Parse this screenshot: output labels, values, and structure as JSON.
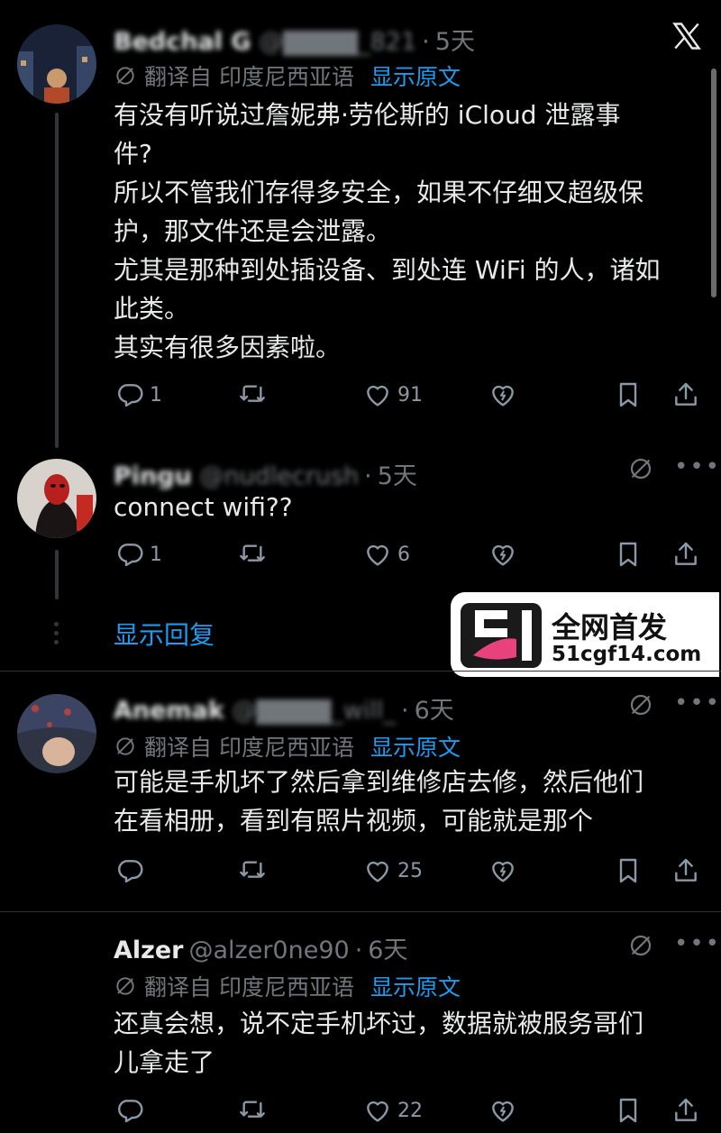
{
  "header": {
    "close_label": "X"
  },
  "posts": [
    {
      "name": "Bedchal G",
      "handle_suffix": "_821",
      "time": "5天",
      "translate": "翻译自 印度尼西亚语",
      "show_original": "显示原文",
      "lines": [
        "有没有听说过詹妮弗·劳伦斯的 iCloud 泄露事",
        "件?",
        "所以不管我们存得多安全，如果不仔细又超级保",
        "护，那文件还是会泄露。",
        "尤其是那种到处插设备、到处连 WiFi 的人，诸如",
        "此类。",
        "其实有很多因素啦。"
      ],
      "replies": "1",
      "likes": "91"
    },
    {
      "name": "Pingu",
      "handle": "@nudlecrush",
      "time": "5天",
      "text": "connect wifi??",
      "replies": "1",
      "likes": "6"
    },
    {
      "name": "Anemak",
      "handle_suffix": "_will_",
      "time": "6天",
      "translate": "翻译自 印度尼西亚语",
      "show_original": "显示原文",
      "lines": [
        "可能是手机坏了然后拿到维修店去修，然后他们",
        "在看相册，看到有照片视频，可能就是那个"
      ],
      "likes": "25"
    },
    {
      "name": "Alzer",
      "handle": "@alzer0ne90",
      "time": "6天",
      "translate": "翻译自 印度尼西亚语",
      "show_original": "显示原文",
      "lines": [
        "还真会想，说不定手机坏过，数据就被服务哥们",
        "儿拿走了"
      ],
      "likes": "22"
    }
  ],
  "show_replies": "显示回复",
  "watermark": {
    "title": "全网首发",
    "url": "51cgf14.com",
    "logo_text": "51"
  },
  "colors": {
    "accent": "#1d9bf0",
    "muted": "#71767b",
    "text": "#e7e9ea",
    "watermark_pink": "#e8427c"
  }
}
